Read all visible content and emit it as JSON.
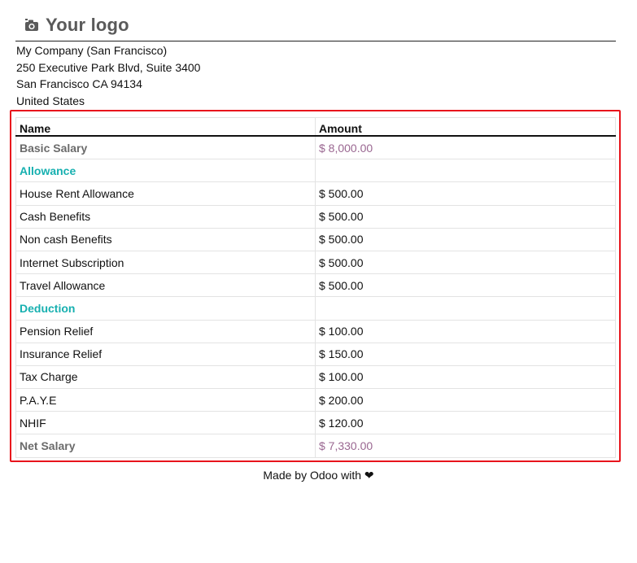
{
  "logo": {
    "text": "Your logo",
    "icon": "camera-icon"
  },
  "company": {
    "lines": [
      "My Company (San Francisco)",
      "250 Executive Park Blvd, Suite 3400",
      "San Francisco CA 94134",
      "United States"
    ]
  },
  "table": {
    "headers": {
      "name": "Name",
      "amount": "Amount"
    },
    "rows": [
      {
        "name": "Basic Salary",
        "amount": "$ 8,000.00",
        "kind": "summary"
      },
      {
        "name": "Allowance",
        "amount": "",
        "kind": "category"
      },
      {
        "name": "House Rent Allowance",
        "amount": "$ 500.00",
        "kind": "line"
      },
      {
        "name": "Cash Benefits",
        "amount": "$ 500.00",
        "kind": "line"
      },
      {
        "name": "Non cash Benefits",
        "amount": "$ 500.00",
        "kind": "line"
      },
      {
        "name": "Internet Subscription",
        "amount": "$ 500.00",
        "kind": "line"
      },
      {
        "name": "Travel Allowance",
        "amount": "$ 500.00",
        "kind": "line"
      },
      {
        "name": "Deduction",
        "amount": "",
        "kind": "category"
      },
      {
        "name": "Pension Relief",
        "amount": "$ 100.00",
        "kind": "line"
      },
      {
        "name": "Insurance Relief",
        "amount": "$ 150.00",
        "kind": "line"
      },
      {
        "name": "Tax Charge",
        "amount": "$ 100.00",
        "kind": "line"
      },
      {
        "name": "P.A.Y.E",
        "amount": "$ 200.00",
        "kind": "line"
      },
      {
        "name": "NHIF",
        "amount": "$ 120.00",
        "kind": "line"
      },
      {
        "name": "Net Salary",
        "amount": "$ 7,330.00",
        "kind": "summary"
      }
    ]
  },
  "colors": {
    "highlight_border": "#e8141c",
    "category_text": "#17b0b0",
    "summary_amount": "#9a6791",
    "summary_name": "#6b6b6b"
  },
  "footer": {
    "text": "Made by Odoo with ❤"
  }
}
